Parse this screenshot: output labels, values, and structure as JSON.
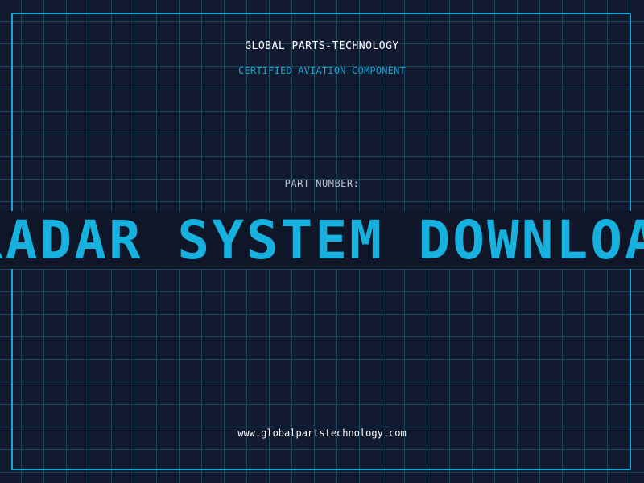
{
  "header": {
    "company": "GLOBAL PARTS-TECHNOLOGY",
    "tagline": "CERTIFIED AVIATION COMPONENT"
  },
  "part": {
    "label": "PART NUMBER:",
    "number": "RADAR SYSTEM DOWNLOAD"
  },
  "footer": {
    "website": "www.globalpartstechnology.com"
  },
  "colors": {
    "background": "#111a2e",
    "grid": "#1e4a66",
    "accent": "#14a5d6",
    "text": "#ffffff"
  }
}
